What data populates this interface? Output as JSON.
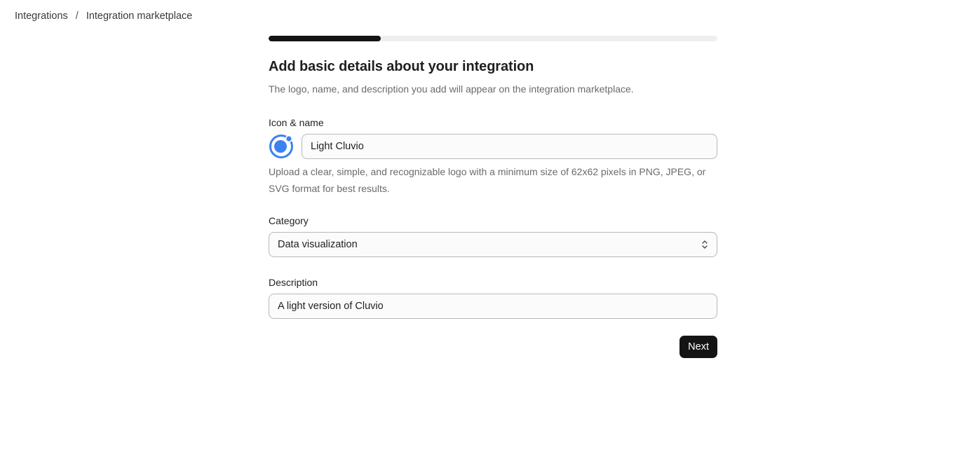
{
  "breadcrumb": {
    "items": [
      "Integrations",
      "Integration marketplace"
    ],
    "separator": "/"
  },
  "progress": {
    "fraction": 0.25
  },
  "form": {
    "title": "Add basic details about your integration",
    "subtitle": "The logo, name, and description you add will appear on the integration marketplace.",
    "icon_name": {
      "label": "Icon & name",
      "icon": "integration-logo-icon",
      "value": "Light Cluvio",
      "help": "Upload a clear, simple, and recognizable logo with a minimum size of 62x62 pixels in PNG, JPEG, or SVG format for best results."
    },
    "category": {
      "label": "Category",
      "value": "Data visualization",
      "icon": "chevron-up-down-icon"
    },
    "description": {
      "label": "Description",
      "value": "A light version of Cluvio"
    },
    "next_label": "Next"
  },
  "colors": {
    "logo_blue": "#3b82f0",
    "progress_fill": "#141414",
    "button_bg": "#141414"
  }
}
